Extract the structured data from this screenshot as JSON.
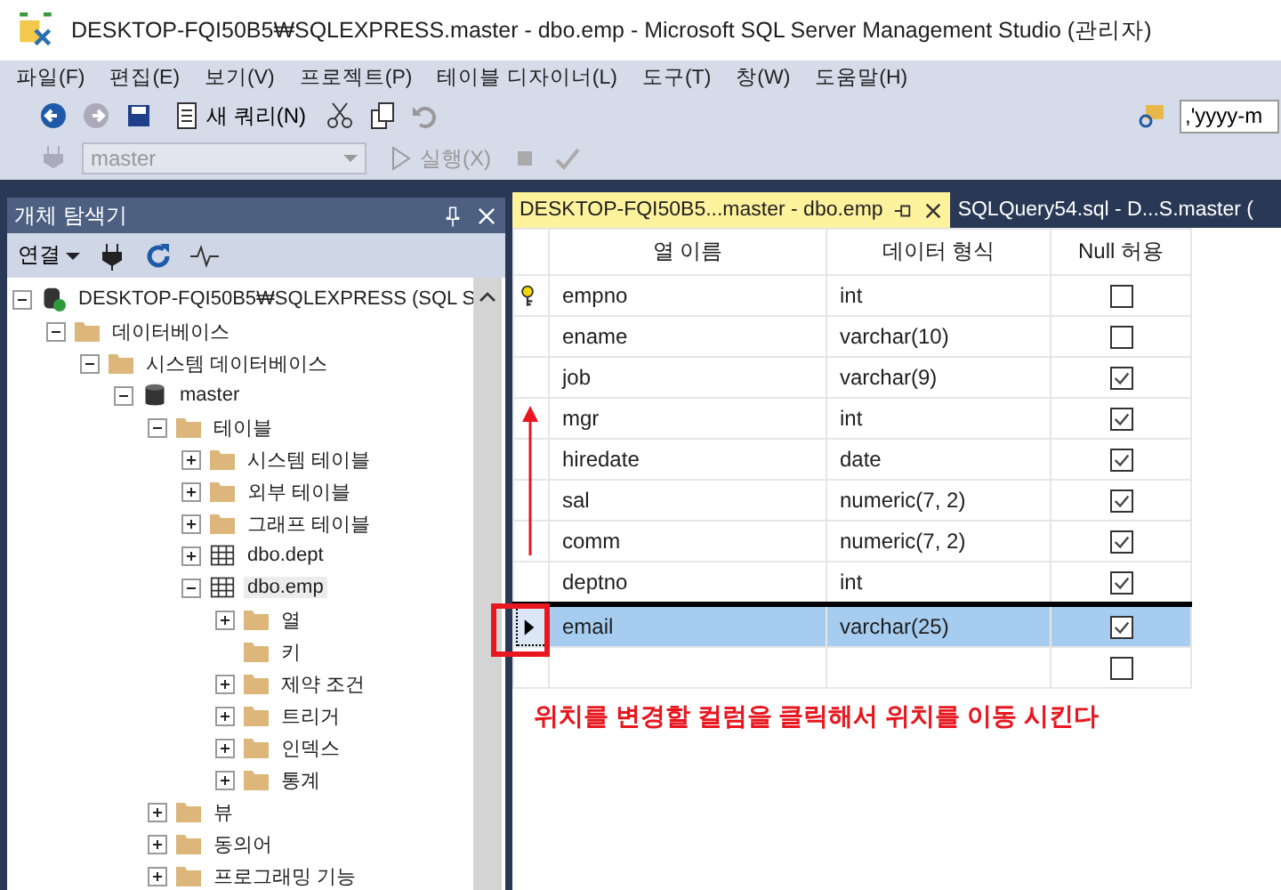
{
  "window": {
    "title": "DESKTOP-FQI50B5₩SQLEXPRESS.master - dbo.emp - Microsoft SQL Server Management Studio (관리자)"
  },
  "menu": [
    "파일(F)",
    "편집(E)",
    "보기(V)",
    "프로젝트(P)",
    "테이블 디자이너(L)",
    "도구(T)",
    "창(W)",
    "도움말(H)"
  ],
  "toolbar": {
    "new_query": "새 쿼리(N)",
    "search_value": ",'yyyy-m",
    "database": "master",
    "execute": "실행(X)"
  },
  "explorer": {
    "title": "개체 탐색기",
    "connect": "연결",
    "tree": [
      {
        "label": "DESKTOP-FQI50B5₩SQLEXPRESS (SQL S",
        "kind": "server",
        "expanded": true,
        "selected": false,
        "children": [
          {
            "label": "데이터베이스",
            "kind": "folder",
            "expanded": true,
            "selected": false,
            "children": [
              {
                "label": "시스템 데이터베이스",
                "kind": "folder",
                "expanded": true,
                "selected": false,
                "children": [
                  {
                    "label": "master",
                    "kind": "database",
                    "expanded": true,
                    "selected": false,
                    "children": [
                      {
                        "label": "테이블",
                        "kind": "folder",
                        "expanded": true,
                        "selected": false,
                        "children": [
                          {
                            "label": "시스템 테이블",
                            "kind": "folder",
                            "expanded": false,
                            "selected": false
                          },
                          {
                            "label": "외부 테이블",
                            "kind": "folder",
                            "expanded": false,
                            "selected": false
                          },
                          {
                            "label": "그래프 테이블",
                            "kind": "folder",
                            "expanded": false,
                            "selected": false
                          },
                          {
                            "label": "dbo.dept",
                            "kind": "table",
                            "expanded": false,
                            "selected": false
                          },
                          {
                            "label": "dbo.emp",
                            "kind": "table",
                            "expanded": true,
                            "selected": true,
                            "children": [
                              {
                                "label": "열",
                                "kind": "folder",
                                "expanded": false,
                                "selected": false
                              },
                              {
                                "label": "키",
                                "kind": "folder",
                                "selected": false
                              },
                              {
                                "label": "제약 조건",
                                "kind": "folder",
                                "expanded": false,
                                "selected": false
                              },
                              {
                                "label": "트리거",
                                "kind": "folder",
                                "expanded": false,
                                "selected": false
                              },
                              {
                                "label": "인덱스",
                                "kind": "folder",
                                "expanded": false,
                                "selected": false
                              },
                              {
                                "label": "통계",
                                "kind": "folder",
                                "expanded": false,
                                "selected": false
                              }
                            ]
                          }
                        ]
                      },
                      {
                        "label": "뷰",
                        "kind": "folder",
                        "expanded": false,
                        "selected": false
                      },
                      {
                        "label": "동의어",
                        "kind": "folder",
                        "expanded": false,
                        "selected": false
                      },
                      {
                        "label": "프로그래밍 기능",
                        "kind": "folder",
                        "expanded": false,
                        "selected": false
                      }
                    ]
                  }
                ]
              }
            ]
          }
        ]
      }
    ]
  },
  "tabs": [
    {
      "label": "DESKTOP-FQI50B5...master - dbo.emp",
      "selected": true
    },
    {
      "label": "SQLQuery54.sql - D...S.master (",
      "selected": false
    }
  ],
  "table": {
    "columns": [
      "열 이름",
      "데이터 형식",
      "Null 허용"
    ],
    "rows": [
      {
        "name": "empno",
        "type": "int",
        "allow_null": false,
        "primary_key": true,
        "selected": false
      },
      {
        "name": "ename",
        "type": "varchar(10)",
        "allow_null": false,
        "primary_key": false,
        "selected": false
      },
      {
        "name": "job",
        "type": "varchar(9)",
        "allow_null": true,
        "primary_key": false,
        "selected": false
      },
      {
        "name": "mgr",
        "type": "int",
        "allow_null": true,
        "primary_key": false,
        "selected": false
      },
      {
        "name": "hiredate",
        "type": "date",
        "allow_null": true,
        "primary_key": false,
        "selected": false
      },
      {
        "name": "sal",
        "type": "numeric(7, 2)",
        "allow_null": true,
        "primary_key": false,
        "selected": false
      },
      {
        "name": "comm",
        "type": "numeric(7, 2)",
        "allow_null": true,
        "primary_key": false,
        "selected": false
      },
      {
        "name": "deptno",
        "type": "int",
        "allow_null": true,
        "primary_key": false,
        "selected": false
      },
      {
        "name": "email",
        "type": "varchar(25)",
        "allow_null": true,
        "primary_key": false,
        "selected": true
      },
      {
        "allow_null": false,
        "primary_key": false,
        "selected": false
      }
    ]
  },
  "annotation": "위치를 변경할 컬럼을 클릭해서 위치를 이동 시킨다"
}
